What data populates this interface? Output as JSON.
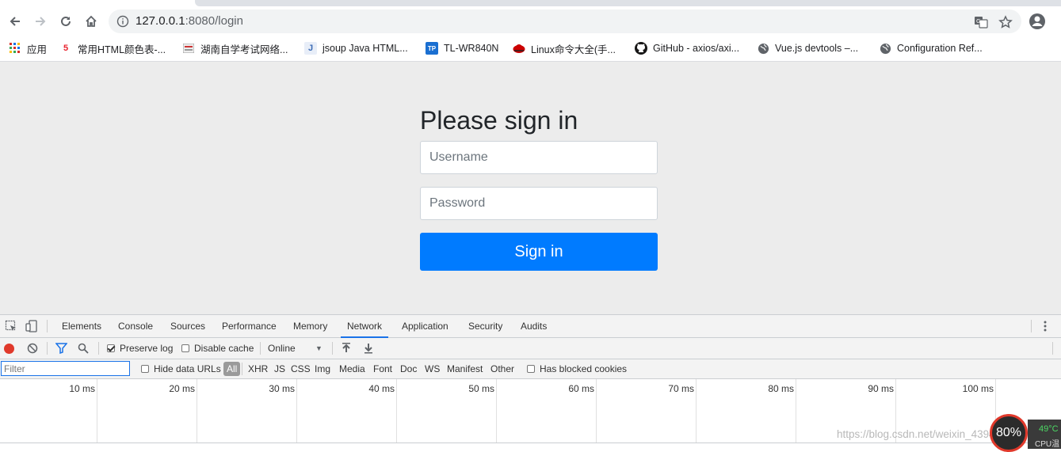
{
  "browser": {
    "url_host": "127.0.0.1",
    "url_rest": ":8080/login"
  },
  "bookmarks": [
    {
      "label": "应用",
      "icon": "apps-grid-icon"
    },
    {
      "label": "常用HTML颜色表-...",
      "icon": "num5-favicon"
    },
    {
      "label": "湖南自学考试网络...",
      "icon": "site-favicon"
    },
    {
      "label": "jsoup Java HTML...",
      "icon": "j-favicon"
    },
    {
      "label": "TL-WR840N",
      "icon": "tp-link-favicon"
    },
    {
      "label": "Linux命令大全(手...",
      "icon": "redhat-favicon"
    },
    {
      "label": "GitHub - axios/axi...",
      "icon": "github-icon"
    },
    {
      "label": "Vue.js devtools –...",
      "icon": "globe-icon"
    },
    {
      "label": "Configuration Ref...",
      "icon": "globe-icon"
    }
  ],
  "signin": {
    "heading": "Please sign in",
    "username_placeholder": "Username",
    "password_placeholder": "Password",
    "button_label": "Sign in"
  },
  "devtools": {
    "tabs": [
      "Elements",
      "Console",
      "Sources",
      "Performance",
      "Memory",
      "Network",
      "Application",
      "Security",
      "Audits"
    ],
    "active_tab": "Network",
    "toolbar": {
      "preserve_log": "Preserve log",
      "disable_cache": "Disable cache",
      "throttle": "Online"
    },
    "filter": {
      "placeholder": "Filter",
      "hide_data_urls": "Hide data URLs",
      "types": [
        "All",
        "XHR",
        "JS",
        "CSS",
        "Img",
        "Media",
        "Font",
        "Doc",
        "WS",
        "Manifest",
        "Other"
      ],
      "has_blocked_cookies": "Has blocked cookies"
    },
    "timeline_ticks": [
      "10 ms",
      "20 ms",
      "30 ms",
      "40 ms",
      "50 ms",
      "60 ms",
      "70 ms",
      "80 ms",
      "90 ms",
      "100 ms"
    ]
  },
  "overlay": {
    "cpu_percent": "80%",
    "cpu_temp": "49°C",
    "cpu_label": "CPU温",
    "watermark": "https://blog.csdn.net/weixin_43944444"
  },
  "colors": {
    "primary_button": "#007bff",
    "devtools_active_underline": "#1a73e8",
    "record_red": "#e0392b"
  }
}
